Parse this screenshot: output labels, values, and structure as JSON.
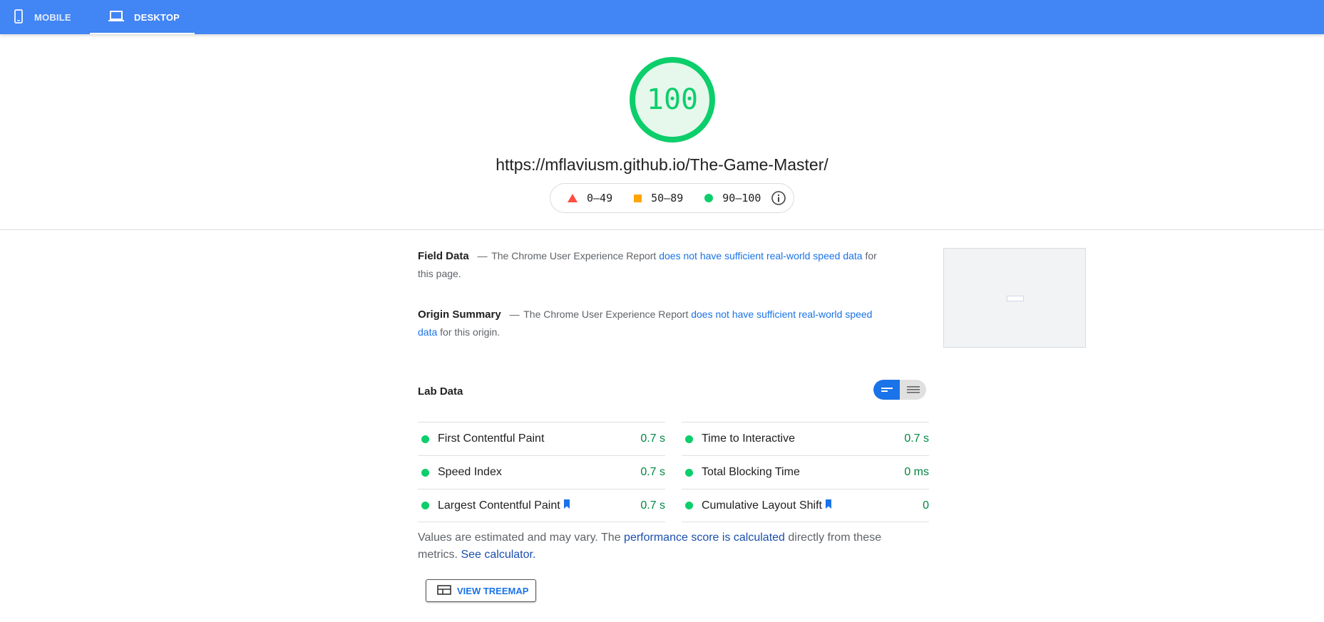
{
  "tabs": {
    "mobile": {
      "label": "MOBILE",
      "icon": "phone-icon"
    },
    "desktop": {
      "label": "DESKTOP",
      "icon": "laptop-icon",
      "active": true
    }
  },
  "score": {
    "value": "100",
    "color": "#0cce6b"
  },
  "url": "https://mflaviusm.github.io/The-Game-Master/",
  "legend": {
    "fail": {
      "label": "0–49",
      "color": "#ff4e42",
      "icon": "triangle"
    },
    "average": {
      "label": "50–89",
      "color": "#ffa400",
      "icon": "square"
    },
    "pass": {
      "label": "90–100",
      "color": "#0cce6b",
      "icon": "circle"
    },
    "info_icon": "info-icon"
  },
  "field_data": {
    "title": "Field Data",
    "dash": "—",
    "text_before": "The Chrome User Experience Report",
    "link": "does not have sufficient real-world speed data",
    "text_after": "for this page."
  },
  "origin_summary": {
    "title": "Origin Summary",
    "dash": "—",
    "text_before": "The Chrome User Experience Report",
    "link": "does not have sufficient real-world speed data",
    "text_after": "for this origin."
  },
  "lab_data": {
    "title": "Lab Data",
    "toggle": {
      "selected": "compact-view",
      "other": "expanded-view"
    },
    "metrics_left": [
      {
        "label": "First Contentful Paint",
        "value": "0.7 s",
        "bookmark": false
      },
      {
        "label": "Speed Index",
        "value": "0.7 s",
        "bookmark": false
      },
      {
        "label": "Largest Contentful Paint",
        "value": "0.7 s",
        "bookmark": true
      }
    ],
    "metrics_right": [
      {
        "label": "Time to Interactive",
        "value": "0.7 s",
        "bookmark": false
      },
      {
        "label": "Total Blocking Time",
        "value": "0 ms",
        "bookmark": false
      },
      {
        "label": "Cumulative Layout Shift",
        "value": "0",
        "bookmark": true
      }
    ]
  },
  "note": {
    "text1": "Values are estimated and may vary. The",
    "link1": "performance score is calculated",
    "text2": "directly from these metrics.",
    "link2": "See calculator."
  },
  "treemap_button": {
    "label": "VIEW TREEMAP",
    "icon": "treemap-icon"
  },
  "colors": {
    "topbar": "#4285f4",
    "link": "#1a73e8",
    "pass_value": "#018642"
  }
}
